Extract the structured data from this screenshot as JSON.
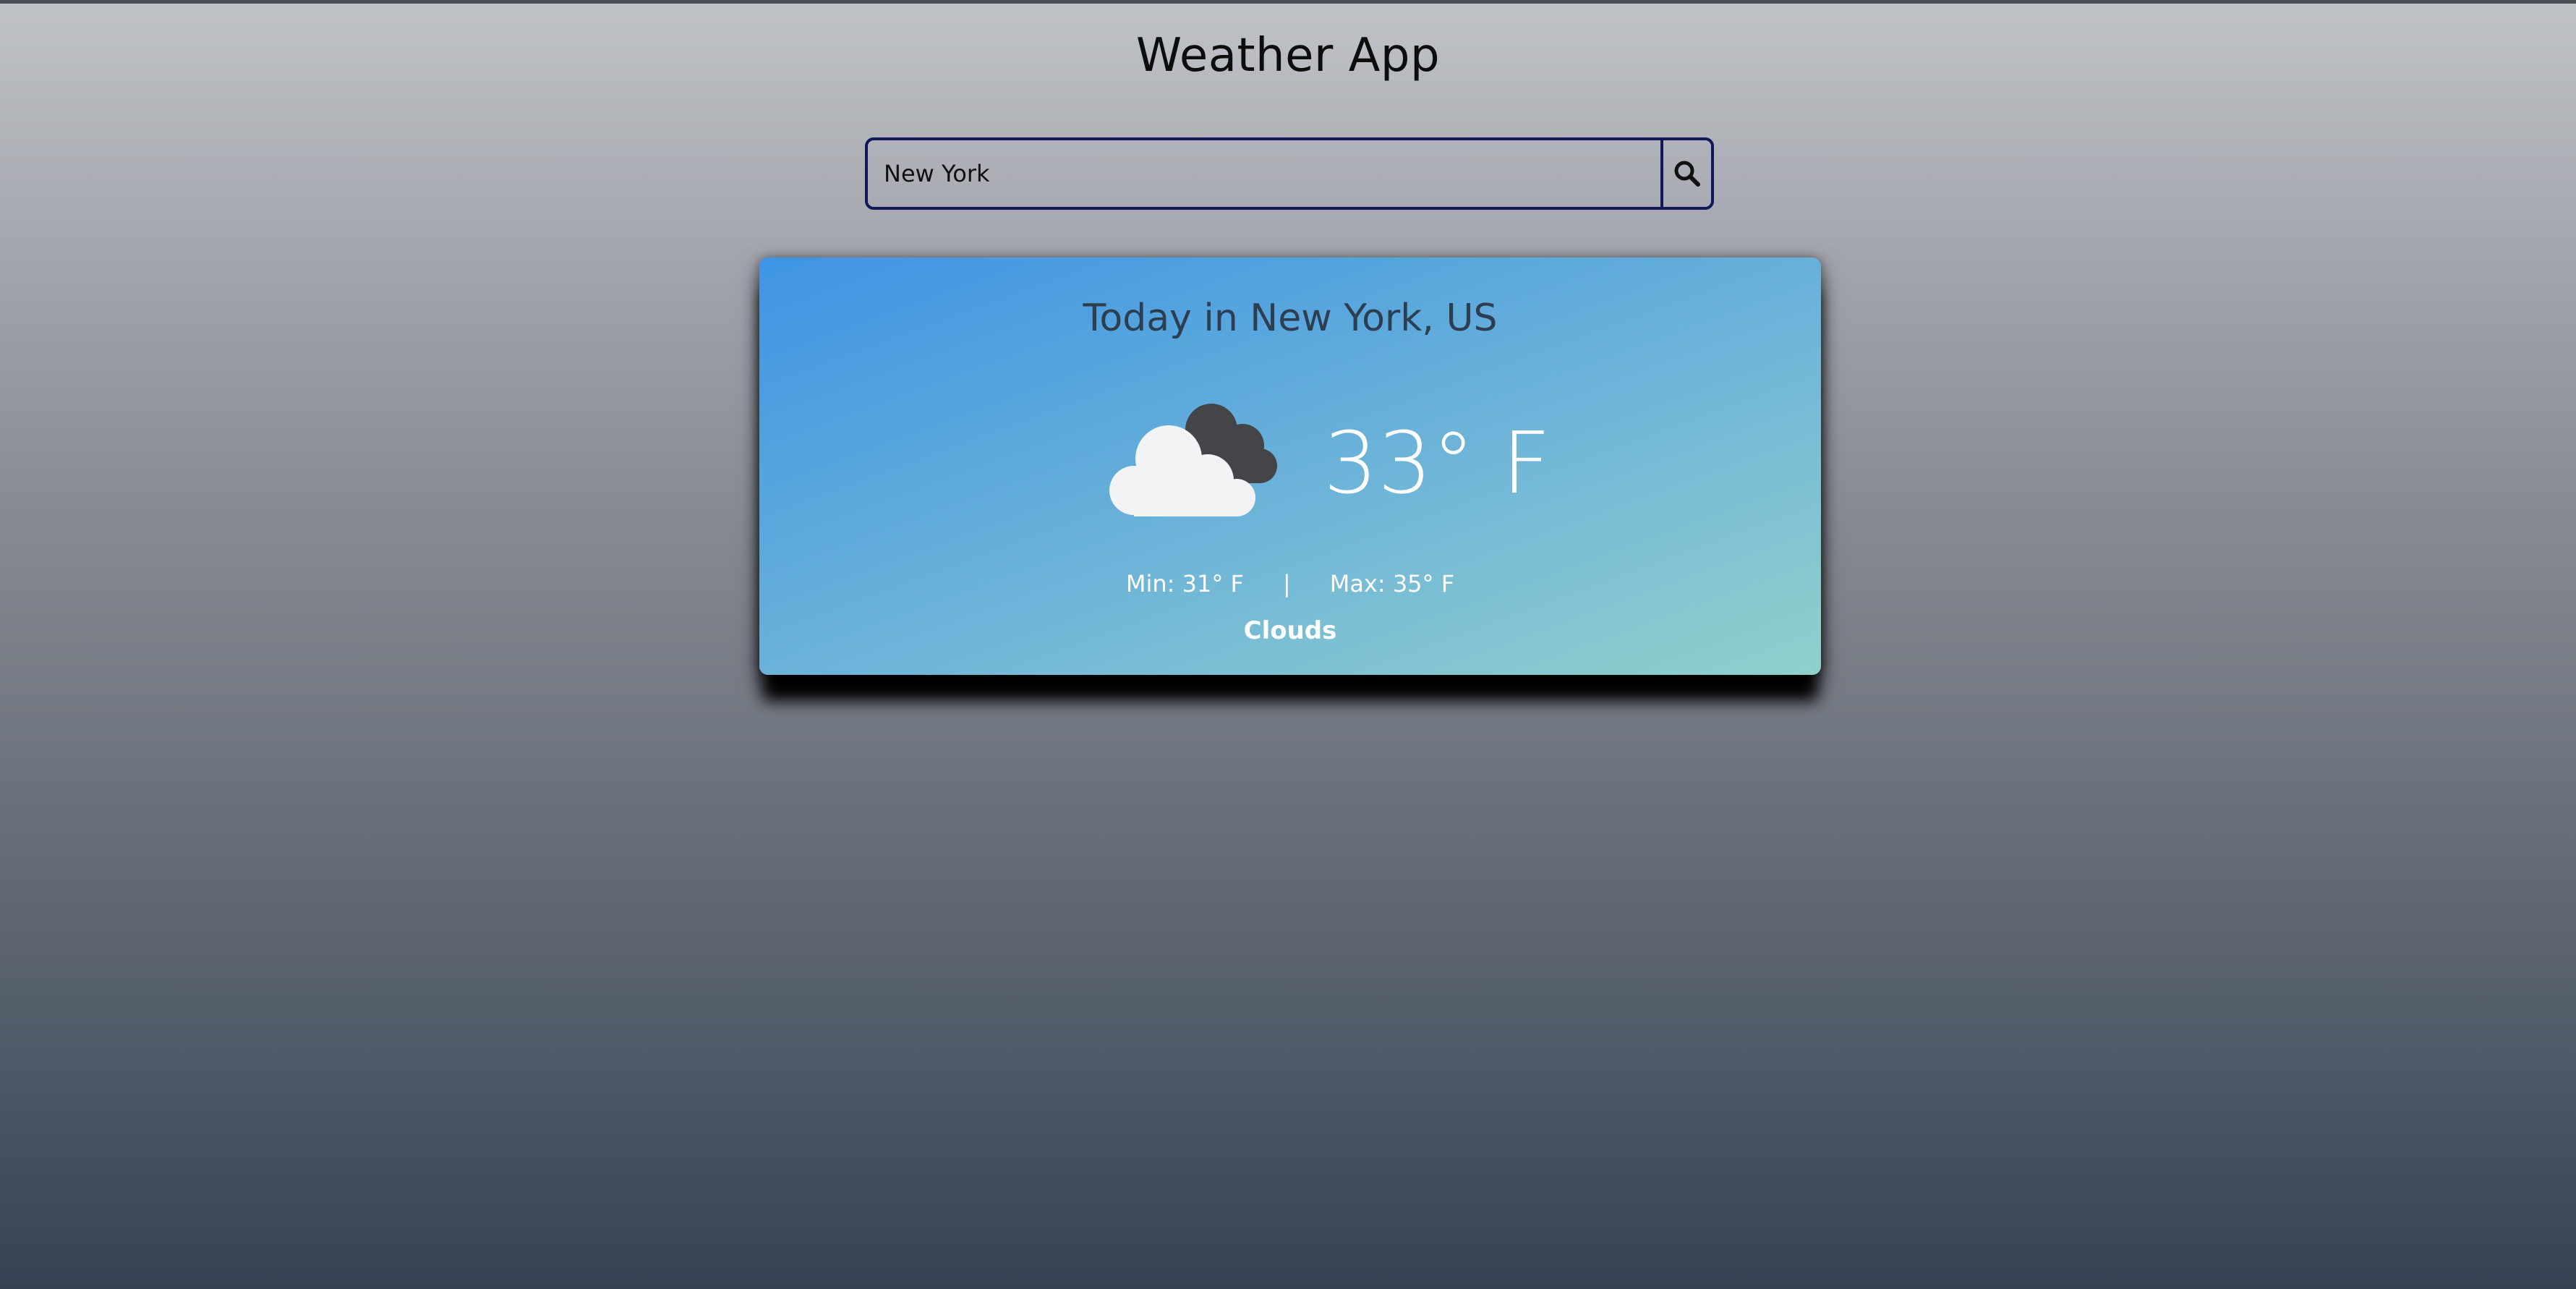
{
  "app": {
    "title": "Weather App"
  },
  "search": {
    "value": "New York",
    "icon": "search-icon"
  },
  "weather": {
    "heading": "Today in New York, US",
    "icon": "clouds-icon",
    "temperature": "33° F",
    "min": "Min: 31° F",
    "separator": "|",
    "max": "Max: 35° F",
    "condition": "Clouds"
  },
  "colors": {
    "search_border": "#10185a",
    "card_gradient_start": "#3f94e4",
    "card_gradient_end": "#90d0cb"
  }
}
